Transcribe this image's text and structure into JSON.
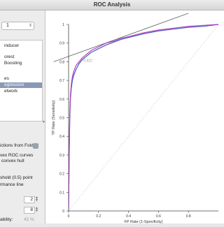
{
  "window": {
    "title": "ROC Analysis"
  },
  "sidebar": {
    "target_value": "1",
    "classifiers": [
      "inducer",
      "orest",
      "Boosting",
      "es",
      "egression",
      "etwork"
    ],
    "selected_index": 4,
    "folds_label": "ictions from Folds",
    "convex_curves_label": "vex ROC curves",
    "convex_hull_label": "convex hull",
    "threshold_label": "shold (0.5) point",
    "perf_line_label": "rmance line",
    "spin1_value": "2",
    "spin2_value": "8",
    "prob_label": "ability:",
    "prob_value": "42 %"
  },
  "chart_data": {
    "type": "line",
    "xlabel": "FP Rate (1-Specificity)",
    "ylabel": "TP Rate (Sensitivity)",
    "xlim": [
      0,
      1
    ],
    "ylim": [
      0,
      1
    ],
    "x_ticks": [
      "0",
      "0.2",
      "0.4",
      "0.6",
      "0.8"
    ],
    "y_ticks": [
      "0",
      "0.1",
      "0.2",
      "0.3",
      "0.4",
      "0.5",
      "0.6",
      "0.7",
      "0.8",
      "0.9",
      "1"
    ],
    "annotation": "0.422",
    "series": [
      {
        "color": "#4a56c4",
        "x": [
          0,
          0.004,
          0.008,
          0.012,
          0.018,
          0.025,
          0.035,
          0.05,
          0.07,
          0.09,
          0.12,
          0.15,
          0.2,
          0.25,
          0.3,
          0.35,
          0.4,
          0.5,
          0.6,
          0.7,
          0.8,
          0.9,
          1.0
        ],
        "y": [
          0,
          0.3,
          0.5,
          0.6,
          0.66,
          0.7,
          0.73,
          0.76,
          0.79,
          0.81,
          0.83,
          0.85,
          0.87,
          0.89,
          0.905,
          0.92,
          0.93,
          0.95,
          0.965,
          0.975,
          0.985,
          0.99,
          1.0
        ]
      },
      {
        "color": "#b040c0",
        "x": [
          0,
          0.004,
          0.008,
          0.012,
          0.018,
          0.025,
          0.035,
          0.05,
          0.07,
          0.09,
          0.12,
          0.15,
          0.2,
          0.25,
          0.3,
          0.35,
          0.4,
          0.5,
          0.6,
          0.7,
          0.8,
          0.9,
          1.0
        ],
        "y": [
          0,
          0.32,
          0.52,
          0.62,
          0.68,
          0.72,
          0.75,
          0.78,
          0.8,
          0.82,
          0.84,
          0.86,
          0.88,
          0.9,
          0.91,
          0.925,
          0.935,
          0.955,
          0.97,
          0.98,
          0.99,
          0.995,
          1.0
        ]
      }
    ],
    "iso_performance_line": {
      "x": [
        -0.1,
        0.8
      ],
      "y": [
        0.8,
        1.06
      ]
    },
    "diagonal": {
      "x": [
        0,
        1
      ],
      "y": [
        0,
        1
      ]
    }
  }
}
